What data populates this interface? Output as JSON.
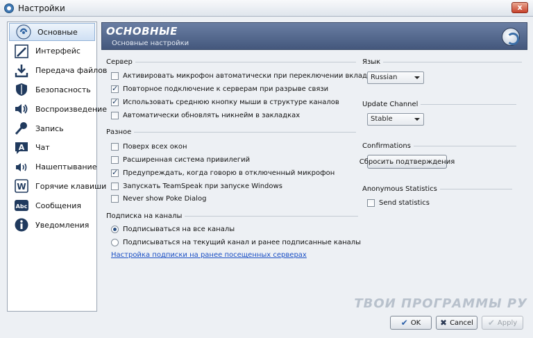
{
  "window": {
    "title": "Настройки",
    "close_glyph": "x"
  },
  "sidebar": {
    "items": [
      {
        "label": "Основные",
        "icon": "teamspeak-icon",
        "active": true
      },
      {
        "label": "Интерфейс",
        "icon": "pen-icon"
      },
      {
        "label": "Передача файлов",
        "icon": "download-icon"
      },
      {
        "label": "Безопасность",
        "icon": "shield-icon"
      },
      {
        "label": "Воспроизведение",
        "icon": "speaker-icon"
      },
      {
        "label": "Запись",
        "icon": "microphone-icon"
      },
      {
        "label": "Чат",
        "icon": "chat-a-icon"
      },
      {
        "label": "Нашептывание",
        "icon": "whisper-icon"
      },
      {
        "label": "Горячие клавиши",
        "icon": "hotkey-w-icon"
      },
      {
        "label": "Сообщения",
        "icon": "abc-icon"
      },
      {
        "label": "Уведомления",
        "icon": "info-icon"
      }
    ]
  },
  "header": {
    "title": "ОСНОВНЫЕ",
    "subtitle": "Основные настройки"
  },
  "server": {
    "title": "Сервер",
    "options": [
      {
        "label": "Активировать микрофон автоматически при переключении вкладки сервера",
        "checked": false
      },
      {
        "label": "Повторное подключение к серверам при разрыве связи",
        "checked": true
      },
      {
        "label": "Использовать среднюю кнопку мыши в структуре каналов",
        "checked": true
      },
      {
        "label": "Автоматически обновлять никнейм в закладках",
        "checked": false
      }
    ]
  },
  "misc": {
    "title": "Разное",
    "options": [
      {
        "label": "Поверх всех окон",
        "checked": false
      },
      {
        "label": "Расширенная система привилегий",
        "checked": false
      },
      {
        "label": "Предупреждать, когда говорю в отключенный микрофон",
        "checked": true
      },
      {
        "label": "Запускать TeamSpeak при запуске Windows",
        "checked": false
      },
      {
        "label": "Never show Poke Dialog",
        "checked": false
      }
    ]
  },
  "subscribe": {
    "title": "Подписка на каналы",
    "options": [
      {
        "label": "Подписываться на все каналы",
        "checked": true
      },
      {
        "label": "Подписываться на текущий канал и ранее подписанные каналы",
        "checked": false
      }
    ],
    "link": "Настройка подписки на ранее посещенных серверах"
  },
  "language": {
    "title": "Язык",
    "value": "Russian"
  },
  "update_channel": {
    "title": "Update Channel",
    "value": "Stable"
  },
  "confirmations": {
    "title": "Confirmations",
    "button": "Сбросить подтверждения"
  },
  "anonymous_stats": {
    "title": "Anonymous Statistics",
    "label": "Send statistics",
    "checked": false
  },
  "footer": {
    "ok": "OK",
    "cancel": "Cancel",
    "apply": "Apply"
  },
  "watermark": "ТВОИ ПРОГРАММЫ РУ"
}
